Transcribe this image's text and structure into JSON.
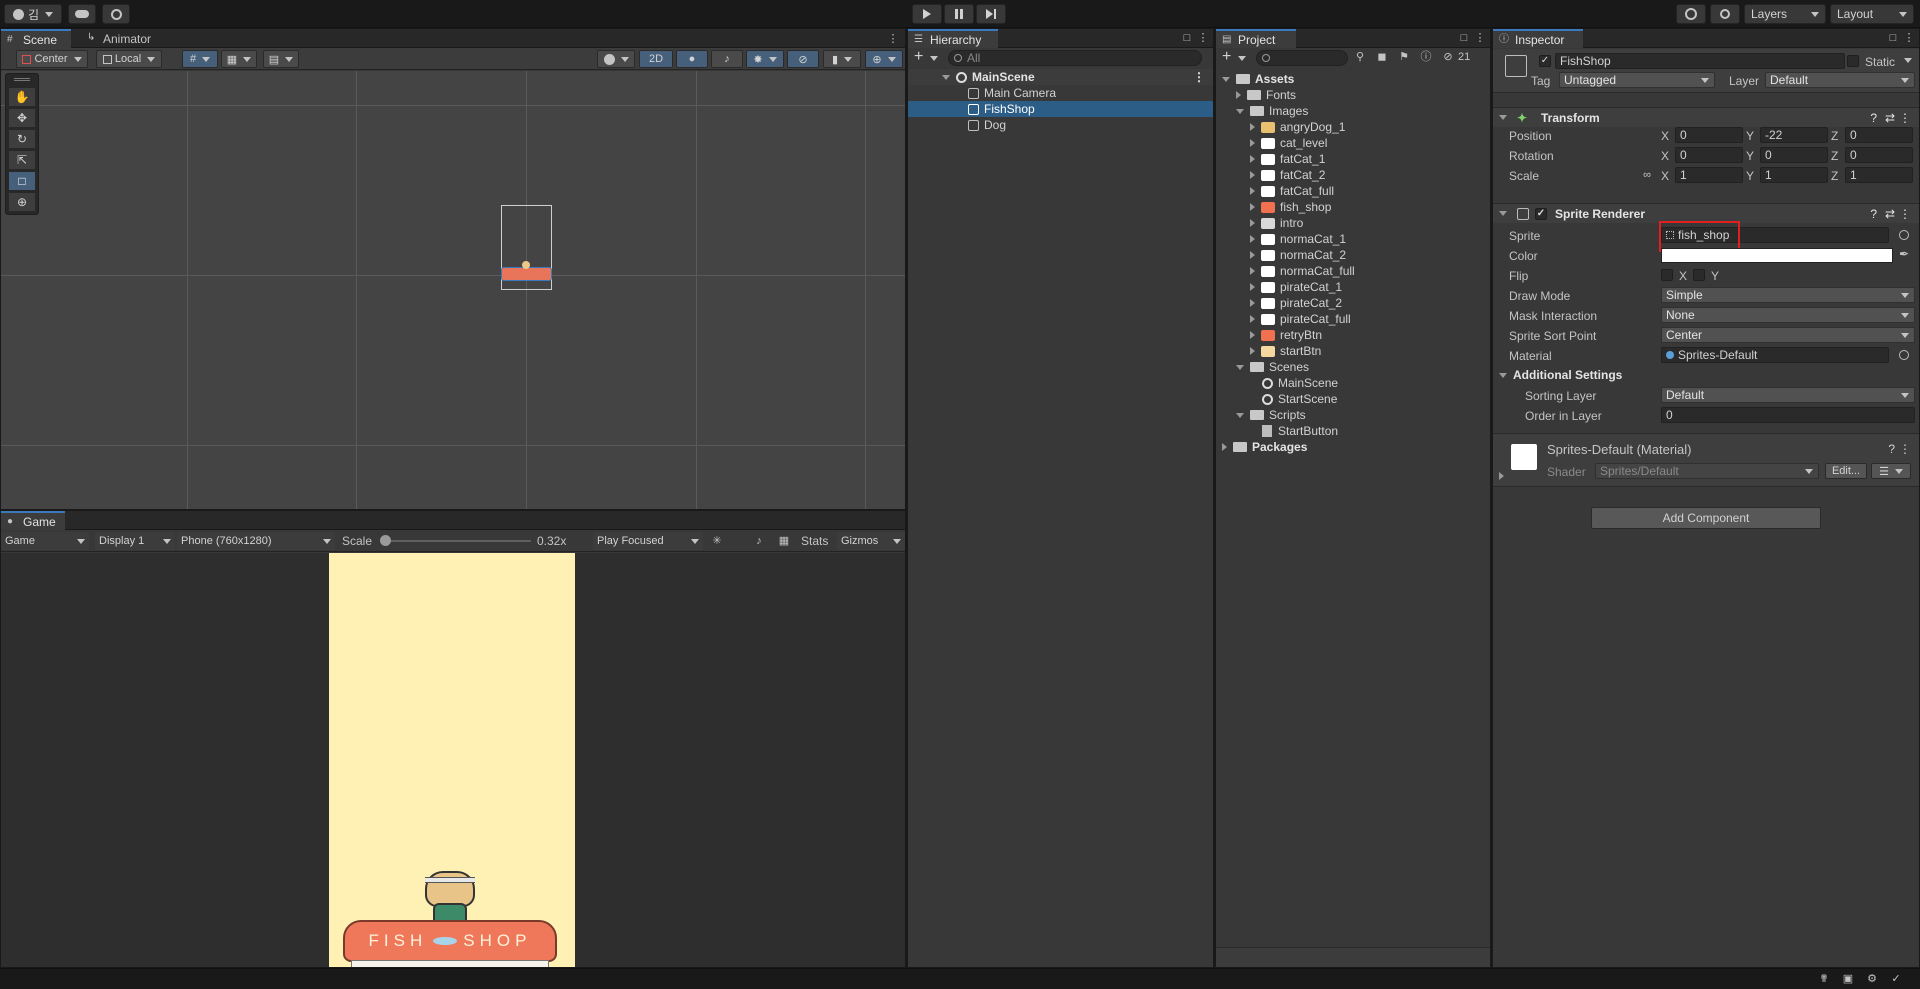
{
  "toolbar": {
    "account_label": "김",
    "layers_label": "Layers",
    "layout_label": "Layout"
  },
  "scene_panel": {
    "tabs": [
      {
        "label": "Scene"
      },
      {
        "label": "Animator"
      }
    ],
    "pivot_label": "Center",
    "space_label": "Local",
    "mode_2d_label": "2D"
  },
  "game_panel": {
    "tab_label": "Game",
    "view_select": "Game",
    "display_select": "Display 1",
    "resolution_select": "Phone (760x1280)",
    "scale_label": "Scale",
    "scale_value": "0.32x",
    "scale_fraction": 0.0,
    "play_mode_select": "Play Focused",
    "stats_label": "Stats",
    "gizmos_label": "Gizmos",
    "sign_text_left": "FISH",
    "sign_text_right": "SHOP"
  },
  "hierarchy": {
    "tab_label": "Hierarchy",
    "search_placeholder": "All",
    "scene_name": "MainScene",
    "items": [
      {
        "label": "Main Camera",
        "selected": false
      },
      {
        "label": "FishShop",
        "selected": true
      },
      {
        "label": "Dog",
        "selected": false
      }
    ]
  },
  "project": {
    "tab_label": "Project",
    "hidden_count": "21",
    "root_label": "Assets",
    "fonts_label": "Fonts",
    "images_label": "Images",
    "images": [
      {
        "label": "angryDog_1"
      },
      {
        "label": "cat_level"
      },
      {
        "label": "fatCat_1"
      },
      {
        "label": "fatCat_2"
      },
      {
        "label": "fatCat_full"
      },
      {
        "label": "fish_shop"
      },
      {
        "label": "intro"
      },
      {
        "label": "normaCat_1"
      },
      {
        "label": "normaCat_2"
      },
      {
        "label": "normaCat_full"
      },
      {
        "label": "pirateCat_1"
      },
      {
        "label": "pirateCat_2"
      },
      {
        "label": "pirateCat_full"
      },
      {
        "label": "retryBtn"
      },
      {
        "label": "startBtn"
      }
    ],
    "scenes_label": "Scenes",
    "scenes": [
      {
        "label": "MainScene"
      },
      {
        "label": "StartScene"
      }
    ],
    "scripts_label": "Scripts",
    "scripts": [
      {
        "label": "StartButton"
      }
    ],
    "packages_label": "Packages"
  },
  "inspector": {
    "tab_label": "Inspector",
    "object_name": "FishShop",
    "static_label": "Static",
    "tag_label": "Tag",
    "tag_value": "Untagged",
    "layer_label": "Layer",
    "layer_value": "Default",
    "transform": {
      "title": "Transform",
      "position_label": "Position",
      "position": {
        "x": "0",
        "y": "-22",
        "z": "0"
      },
      "rotation_label": "Rotation",
      "rotation": {
        "x": "0",
        "y": "0",
        "z": "0"
      },
      "scale_label": "Scale",
      "scale": {
        "x": "1",
        "y": "1",
        "z": "1"
      }
    },
    "axis_x": "X",
    "axis_y": "Y",
    "axis_z": "Z",
    "sprite_renderer": {
      "title": "Sprite Renderer",
      "sprite_label": "Sprite",
      "sprite_value": "fish_shop",
      "color_label": "Color",
      "color_value": "#ffffff",
      "flip_label": "Flip",
      "draw_mode_label": "Draw Mode",
      "draw_mode_value": "Simple",
      "mask_label": "Mask Interaction",
      "mask_value": "None",
      "sort_point_label": "Sprite Sort Point",
      "sort_point_value": "Center",
      "material_label": "Material",
      "material_value": "Sprites-Default",
      "additional_label": "Additional Settings",
      "sorting_layer_label": "Sorting Layer",
      "sorting_layer_value": "Default",
      "order_label": "Order in Layer",
      "order_value": "0"
    },
    "material": {
      "title": "Sprites-Default (Material)",
      "shader_label": "Shader",
      "shader_value": "Sprites/Default",
      "edit_label": "Edit..."
    },
    "add_component_label": "Add Component"
  },
  "colors": {
    "accent": "#2c5d87",
    "highlight_box": "#e02020",
    "game_bg": "#fff0b3",
    "sign_color": "#f0785a"
  }
}
